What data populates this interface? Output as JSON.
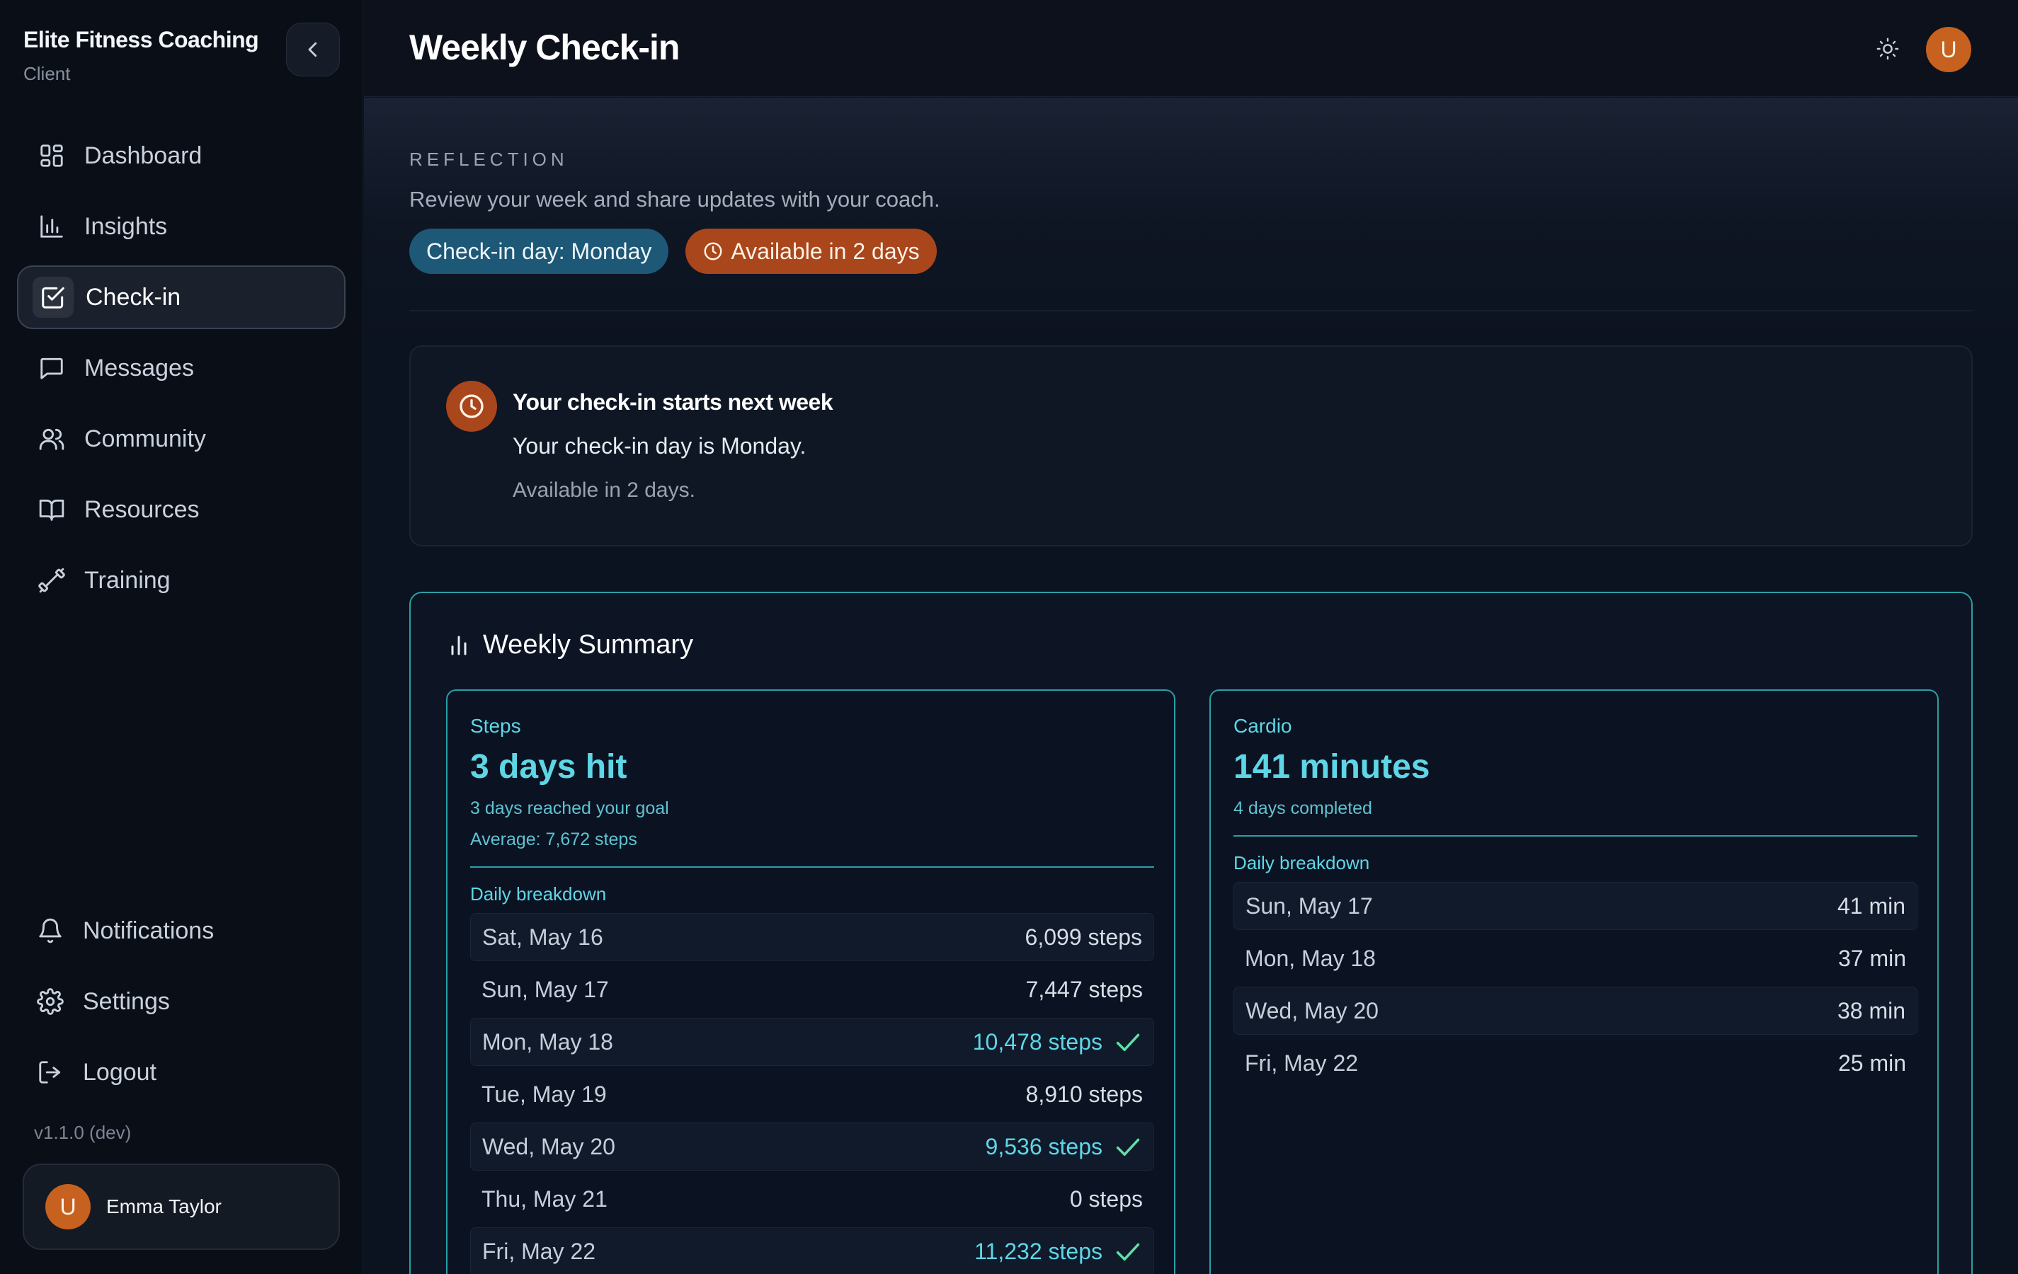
{
  "brand": {
    "name": "Elite Fitness Coaching",
    "role": "Client"
  },
  "sidebar": {
    "items": [
      {
        "label": "Dashboard",
        "icon": "dashboard-icon"
      },
      {
        "label": "Insights",
        "icon": "bar-chart-icon"
      },
      {
        "label": "Check-in",
        "icon": "check-square-icon",
        "active": true
      },
      {
        "label": "Messages",
        "icon": "message-icon"
      },
      {
        "label": "Community",
        "icon": "users-icon"
      },
      {
        "label": "Resources",
        "icon": "book-icon"
      },
      {
        "label": "Training",
        "icon": "dumbbell-icon"
      }
    ],
    "bottom_items": [
      {
        "label": "Notifications",
        "icon": "bell-icon"
      },
      {
        "label": "Settings",
        "icon": "gear-icon"
      },
      {
        "label": "Logout",
        "icon": "logout-icon"
      }
    ],
    "version": "v1.1.0 (dev)",
    "user": {
      "initial": "U",
      "name": "Emma Taylor"
    }
  },
  "header": {
    "title": "Weekly Check-in",
    "avatar_initial": "U"
  },
  "reflection": {
    "label": "REFLECTION",
    "description": "Review your week and share updates with your coach.",
    "chip_day": "Check-in day: Monday",
    "chip_available": "Available in 2 days"
  },
  "notice": {
    "title": "Your check-in starts next week",
    "line1": "Your check-in day is Monday.",
    "line2": "Available in 2 days."
  },
  "summary": {
    "title": "Weekly Summary",
    "steps": {
      "label": "Steps",
      "value": "3 days hit",
      "sub1": "3 days reached your goal",
      "sub2": "Average: 7,672 steps",
      "breakdown_label": "Daily breakdown",
      "rows": [
        {
          "day": "Sat, May 16",
          "value": "6,099 steps",
          "hit": false
        },
        {
          "day": "Sun, May 17",
          "value": "7,447 steps",
          "hit": false
        },
        {
          "day": "Mon, May 18",
          "value": "10,478 steps",
          "hit": true
        },
        {
          "day": "Tue, May 19",
          "value": "8,910 steps",
          "hit": false
        },
        {
          "day": "Wed, May 20",
          "value": "9,536 steps",
          "hit": true
        },
        {
          "day": "Thu, May 21",
          "value": "0 steps",
          "hit": false
        },
        {
          "day": "Fri, May 22",
          "value": "11,232 steps",
          "hit": true
        }
      ]
    },
    "cardio": {
      "label": "Cardio",
      "value": "141 minutes",
      "sub1": "4 days completed",
      "breakdown_label": "Daily breakdown",
      "rows": [
        {
          "day": "Sun, May 17",
          "value": "41 min"
        },
        {
          "day": "Mon, May 18",
          "value": "37 min"
        },
        {
          "day": "Wed, May 20",
          "value": "38 min"
        },
        {
          "day": "Fri, May 22",
          "value": "25 min"
        }
      ]
    }
  },
  "colors": {
    "accent_teal": "#5fd6e6",
    "accent_orange": "#a9461b",
    "chip_blue": "#1d5877",
    "avatar": "#c7611f",
    "hit_check": "#5fe0a8"
  }
}
